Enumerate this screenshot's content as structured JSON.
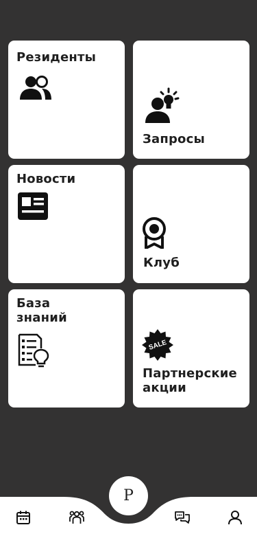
{
  "tiles": {
    "residents": {
      "label": "Резиденты",
      "icon": "people-icon"
    },
    "requests": {
      "label": "Запросы",
      "icon": "idea-person-icon"
    },
    "news": {
      "label": "Новости",
      "icon": "newspaper-icon"
    },
    "club": {
      "label": "Клуб",
      "icon": "award-ribbon-icon"
    },
    "knowledge_base": {
      "label": "База\nзнаний",
      "icon": "document-lightbulb-icon"
    },
    "partner_promos": {
      "label": "Партнерские\nакции",
      "icon": "sale-badge-icon",
      "badge_text": "SALE"
    }
  },
  "bottom_nav": {
    "center_label": "P",
    "items": [
      {
        "name": "calendar",
        "icon": "calendar-icon"
      },
      {
        "name": "community",
        "icon": "group-icon"
      },
      {
        "name": "chat",
        "icon": "chat-icon"
      },
      {
        "name": "profile",
        "icon": "user-icon"
      }
    ]
  },
  "colors": {
    "background": "#333232",
    "tile": "#ffffff",
    "text": "#1f1f1f"
  }
}
